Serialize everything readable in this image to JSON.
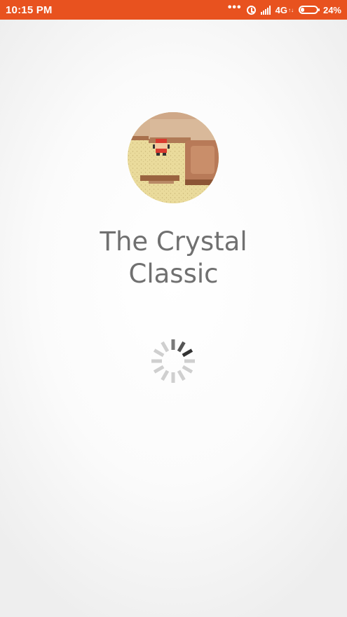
{
  "status_bar": {
    "time": "10:15 PM",
    "network": "4G",
    "network_sub": "↑↓",
    "battery_percent": "24%",
    "battery_level": 0.24,
    "icons": [
      "more-dots-icon",
      "alarm-icon",
      "signal-icon",
      "battery-icon"
    ]
  },
  "splash": {
    "app_name_line1": "The Crystal",
    "app_name_line2": "Classic",
    "loading": true
  }
}
